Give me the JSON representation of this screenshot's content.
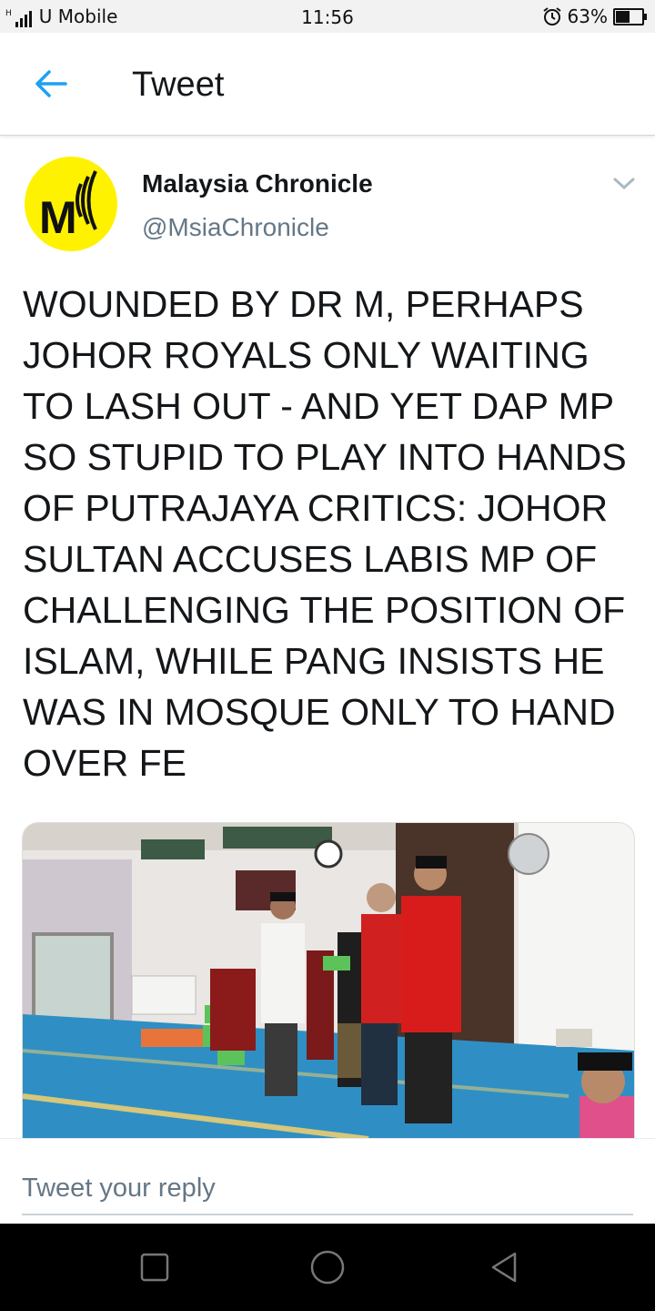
{
  "status_bar": {
    "network_type": "H",
    "carrier": "U Mobile",
    "time": "11:56",
    "battery_percent": "63%",
    "battery_level": 0.63,
    "alarm_icon": "alarm-clock-icon"
  },
  "header": {
    "back_icon": "arrow-left-icon",
    "title": "Tweet"
  },
  "tweet": {
    "author_name": "Malaysia Chronicle",
    "author_handle": "@MsiaChronicle",
    "avatar_letter": "M",
    "text": "WOUNDED BY DR M, PERHAPS JOHOR ROYALS ONLY WAITING TO LASH OUT - AND YET DAP MP SO STUPID TO PLAY INTO HANDS OF PUTRAJAYA CRITICS: JOHOR SULTAN ACCUSES LABIS MP OF CHALLENGING THE POSITION OF ISLAM, WHILE PANG INSISTS HE WAS IN MOSQUE ONLY TO HAND OVER FE",
    "menu_icon": "chevron-down-icon"
  },
  "reply": {
    "placeholder": "Tweet your reply"
  },
  "colors": {
    "accent": "#1da1f2",
    "avatar_bg": "#fff200",
    "handle": "#657786"
  }
}
